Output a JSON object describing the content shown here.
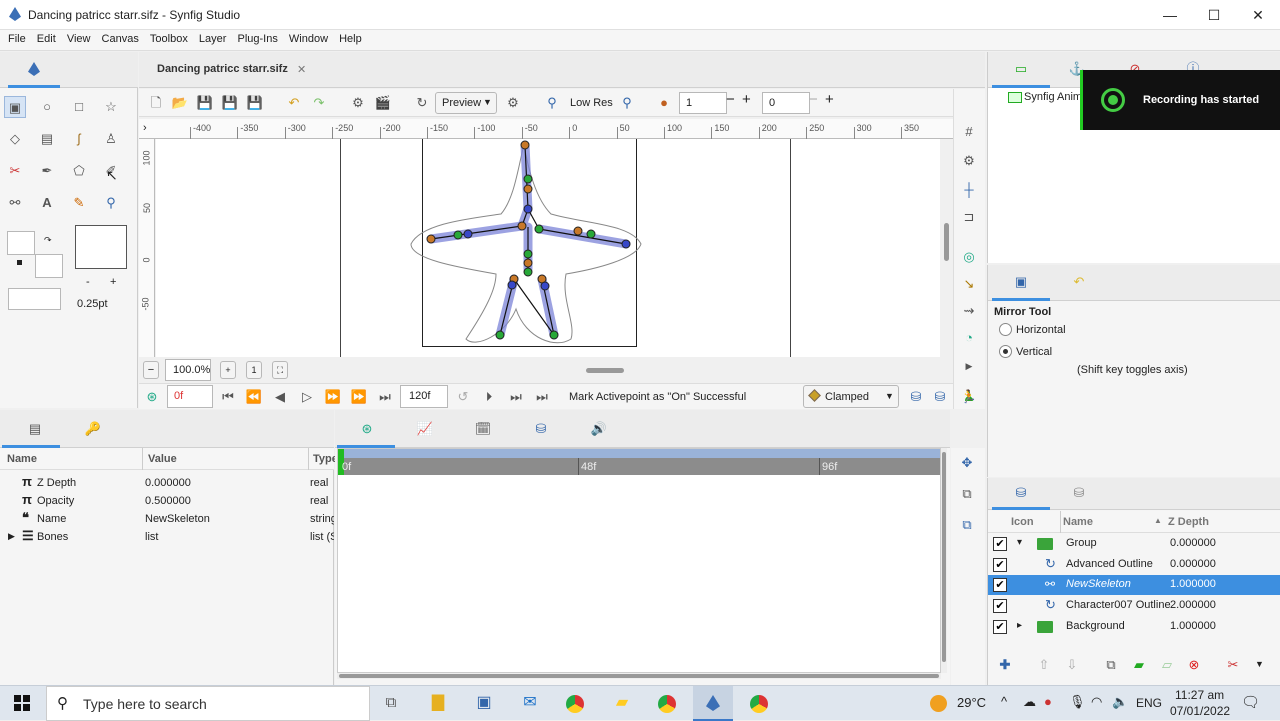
{
  "window": {
    "title": "Dancing patricc starr.sifz - Synfig Studio",
    "min": "—",
    "max": "☐",
    "close": "✕"
  },
  "menu": [
    "File",
    "Edit",
    "View",
    "Canvas",
    "Toolbox",
    "Layer",
    "Plug-Ins",
    "Window",
    "Help"
  ],
  "doc_tab": {
    "title": "Dancing patricc starr.sifz",
    "close": "✕"
  },
  "canvas_toolbar": {
    "preview": "Preview",
    "low_res": "Low Res",
    "frame_a": "1",
    "frame_b": "0"
  },
  "ruler": [
    "-400",
    "-350",
    "-300",
    "-250",
    "-200",
    "-150",
    "-100",
    "-50",
    "0",
    "50",
    "100",
    "150",
    "200",
    "250",
    "300",
    "350"
  ],
  "vruler": [
    "100",
    "50",
    "0",
    "-50"
  ],
  "zoom": "100.0%",
  "transport": {
    "current_frame": "0f",
    "end_frame": "120f",
    "status": "Mark Activepoint as \"On\" Successful",
    "interpolation": "Clamped"
  },
  "toolbox": {
    "outline_width": "0.25pt",
    "minus": "-",
    "plus": "+"
  },
  "params": {
    "headers": [
      "Name",
      "Value",
      "Type"
    ],
    "rows": [
      {
        "icon": "π",
        "name": "Z Depth",
        "value": "0.000000",
        "type": "real"
      },
      {
        "icon": "π",
        "name": "Opacity",
        "value": "0.500000",
        "type": "real"
      },
      {
        "icon": "❝",
        "name": "Name",
        "value": "NewSkeleton",
        "type": "string"
      },
      {
        "icon": "☰",
        "name": "Bones",
        "value": "list",
        "type": "list (S"
      }
    ]
  },
  "timetrack": {
    "marks": [
      "0f",
      "48f",
      "96f"
    ]
  },
  "canvas_browser": {
    "item": "Synfig Anima"
  },
  "notification": "Recording has started",
  "tool_options": {
    "title": "Mirror Tool",
    "opt1": "Horizontal",
    "opt2": "Vertical",
    "hint": "(Shift key toggles axis)"
  },
  "layers": {
    "headers": [
      "Icon",
      "Name",
      "Z Depth"
    ],
    "rows": [
      {
        "name": "Group",
        "z": "0.000000",
        "indent": 0,
        "expand": "▾",
        "kind": "folder",
        "selected": false
      },
      {
        "name": "Advanced Outline",
        "z": "0.000000",
        "indent": 1,
        "expand": "",
        "kind": "outline",
        "selected": false
      },
      {
        "name": "NewSkeleton",
        "z": "1.000000",
        "indent": 1,
        "expand": "",
        "kind": "skeleton",
        "selected": true
      },
      {
        "name": "Character007 Outline",
        "z": "2.000000",
        "indent": 1,
        "expand": "",
        "kind": "outline",
        "selected": false
      },
      {
        "name": "Background",
        "z": "1.000000",
        "indent": 0,
        "expand": "▸",
        "kind": "folder",
        "selected": false
      }
    ]
  },
  "taskbar": {
    "search": "Type here to search",
    "temp": "29°C",
    "lang": "ENG",
    "time": "11:27 am",
    "date": "07/01/2022"
  },
  "colors": {
    "accent": "#0078d7",
    "selection": "#3d8fe0",
    "bone": "#7b83d8",
    "record": "#e02020"
  }
}
